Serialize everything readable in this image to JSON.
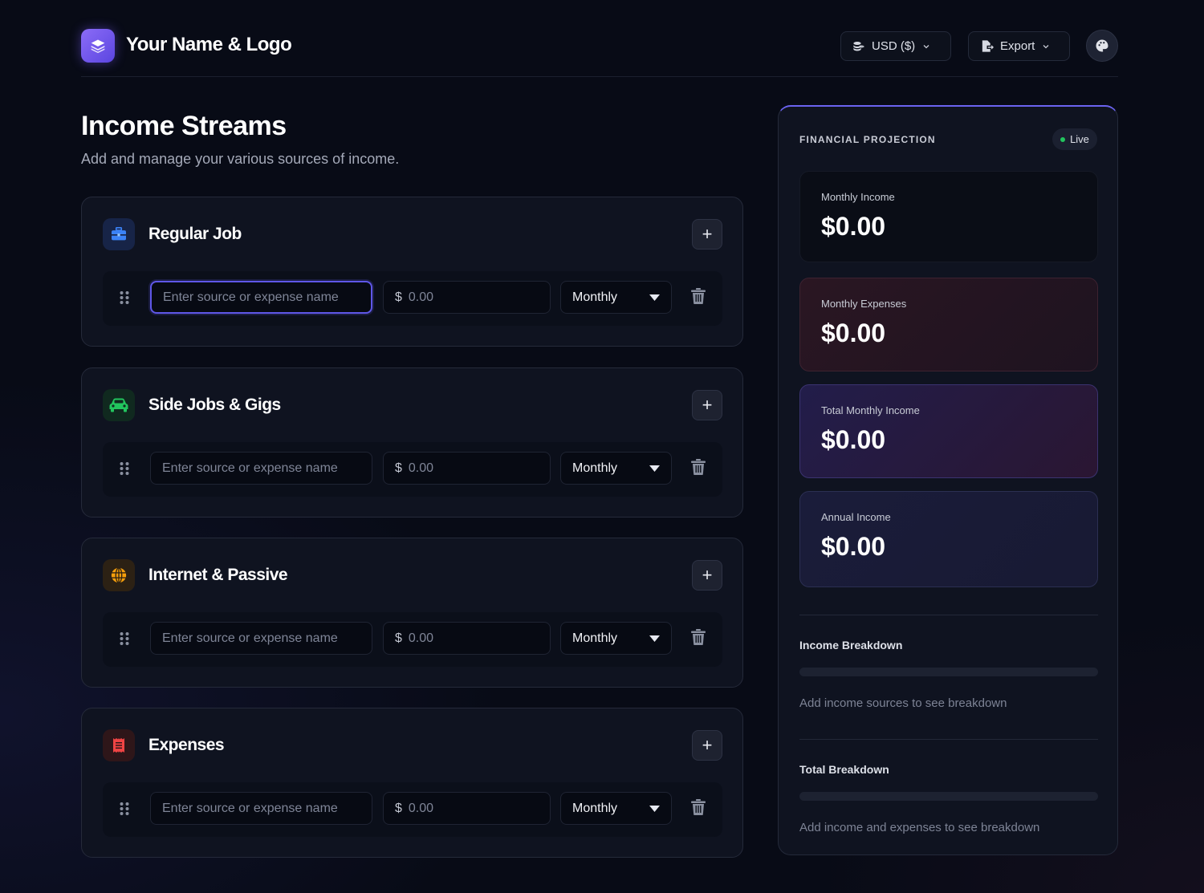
{
  "header": {
    "brand": "Your Name & Logo",
    "currency_label": "USD ($)",
    "export_label": "Export"
  },
  "main": {
    "title": "Income Streams",
    "subtitle": "Add and manage your various sources of income."
  },
  "categories": [
    {
      "title": "Regular Job",
      "icon": "briefcase-icon",
      "icon_color": "#3b82f6",
      "row": {
        "name_placeholder": "Enter source or expense name",
        "currency_symbol": "$",
        "amount_placeholder": "0.00",
        "frequency": "Monthly"
      }
    },
    {
      "title": "Side Jobs & Gigs",
      "icon": "car-icon",
      "icon_color": "#22c55e",
      "row": {
        "name_placeholder": "Enter source or expense name",
        "currency_symbol": "$",
        "amount_placeholder": "0.00",
        "frequency": "Monthly"
      }
    },
    {
      "title": "Internet & Passive",
      "icon": "globe-icon",
      "icon_color": "#f59e0b",
      "row": {
        "name_placeholder": "Enter source or expense name",
        "currency_symbol": "$",
        "amount_placeholder": "0.00",
        "frequency": "Monthly"
      }
    },
    {
      "title": "Expenses",
      "icon": "receipt-icon",
      "icon_color": "#ef4444",
      "row": {
        "name_placeholder": "Enter source or expense name",
        "currency_symbol": "$",
        "amount_placeholder": "0.00",
        "frequency": "Monthly"
      }
    }
  ],
  "projection": {
    "title": "FINANCIAL PROJECTION",
    "live_label": "Live",
    "stats": [
      {
        "label": "Monthly Income",
        "value": "$0.00"
      },
      {
        "label": "Monthly Expenses",
        "value": "$0.00"
      },
      {
        "label": "Total Monthly Income",
        "value": "$0.00"
      },
      {
        "label": "Annual Income",
        "value": "$0.00"
      }
    ],
    "income_breakdown": {
      "title": "Income Breakdown",
      "hint": "Add income sources to see breakdown"
    },
    "total_breakdown": {
      "title": "Total Breakdown",
      "hint": "Add income and expenses to see breakdown"
    }
  },
  "colors": {
    "accent": "#6b63f0",
    "live_dot": "#22c55e",
    "background": "#080b16"
  }
}
